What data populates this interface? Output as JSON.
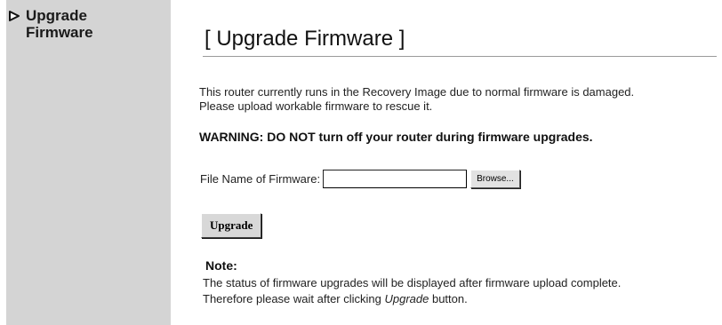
{
  "sidebar": {
    "items": [
      {
        "label_line1": "Upgrade",
        "label_line2": "Firmware",
        "icon": "triangle-bullet-icon"
      }
    ]
  },
  "main": {
    "title": "[ Upgrade Firmware ]",
    "description_line1": "This router currently runs in the Recovery Image due to normal firmware is damaged.",
    "description_line2": "Please upload workable firmware to rescue it.",
    "warning": "WARNING: DO NOT turn off your router during firmware upgrades.",
    "file_label": "File Name of Firmware:",
    "file_value": "",
    "browse_label": "Browse...",
    "upgrade_label": "Upgrade",
    "note_title": "Note:",
    "note_line1": "The status of firmware upgrades will be displayed after firmware upload complete.",
    "note_line2_pre": "Therefore please wait after clicking ",
    "note_line2_em": "Upgrade",
    "note_line2_post": " button."
  },
  "colors": {
    "sidebar_bg": "#d4d4d4",
    "button_bg": "#d8d8d8",
    "rule": "#9a9a9a"
  }
}
